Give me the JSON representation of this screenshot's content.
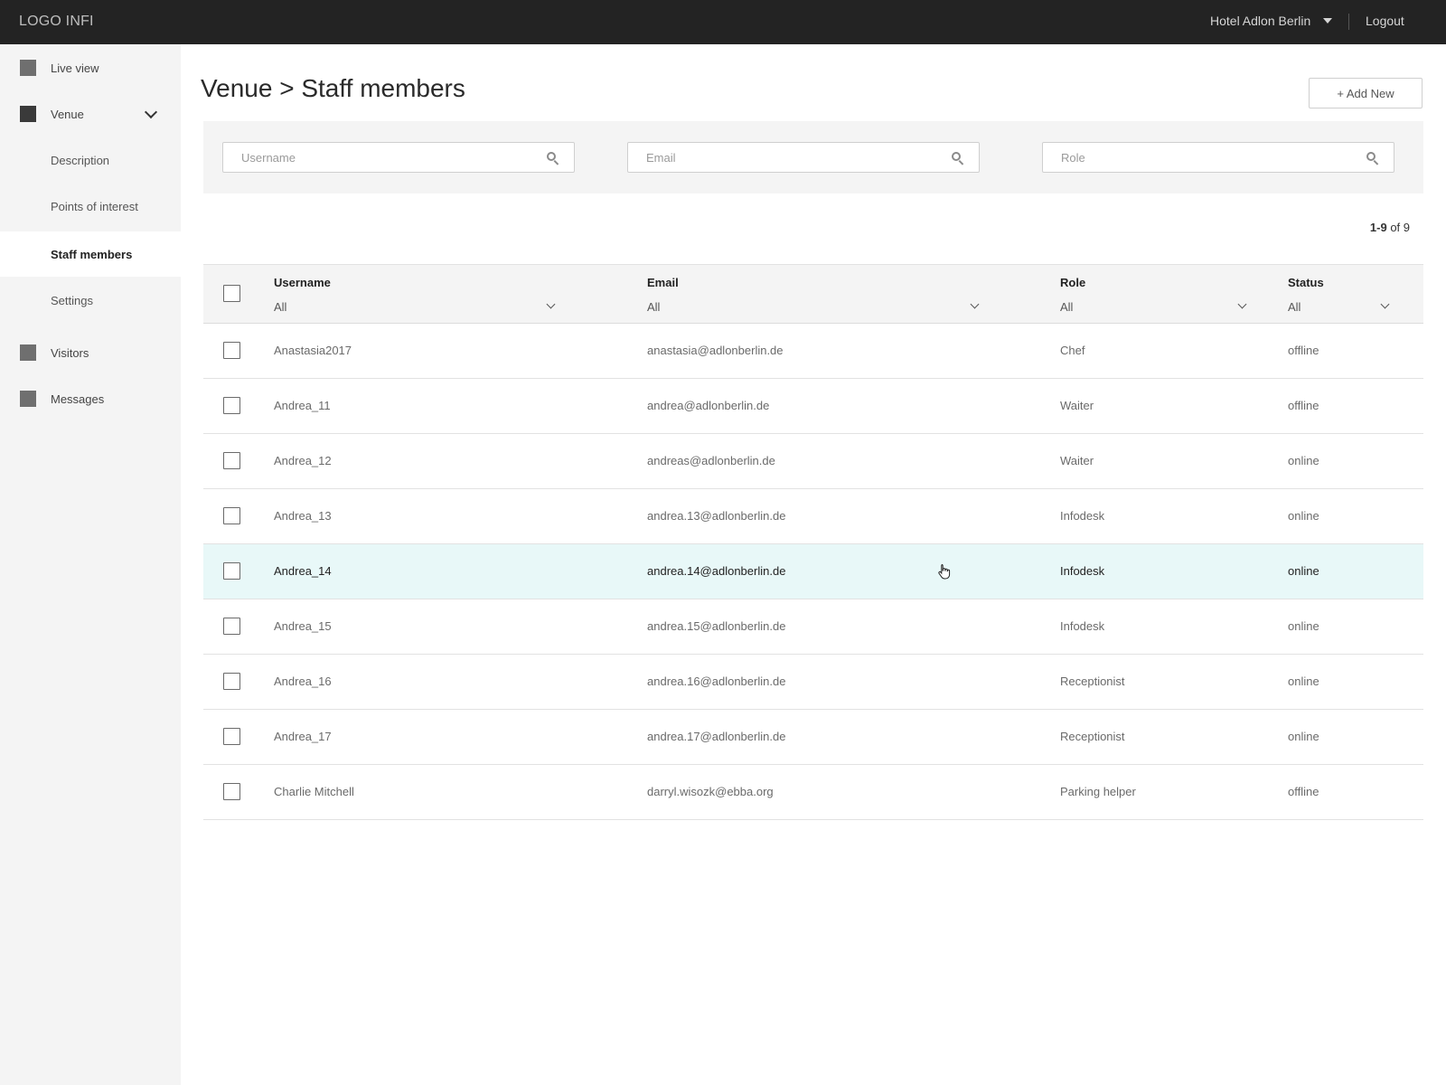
{
  "topbar": {
    "logo": "LOGO INFI",
    "venue": "Hotel Adlon Berlin",
    "logout": "Logout"
  },
  "sidebar": {
    "items": [
      {
        "label": "Live view"
      },
      {
        "label": "Venue"
      },
      {
        "label": "Description"
      },
      {
        "label": "Points of interest"
      },
      {
        "label": "Staff members",
        "active": true
      },
      {
        "label": "Settings"
      },
      {
        "label": "Visitors"
      },
      {
        "label": "Messages"
      }
    ]
  },
  "main": {
    "title": "Venue > Staff members",
    "add_button": "+ Add New",
    "search": {
      "username_placeholder": "Username",
      "email_placeholder": "Email",
      "role_placeholder": "Role"
    },
    "count_range": "1-9",
    "count_of": "of 9"
  },
  "table": {
    "columns": [
      {
        "label": "Username",
        "filter": "All"
      },
      {
        "label": "Email",
        "filter": "All"
      },
      {
        "label": "Role",
        "filter": "All"
      },
      {
        "label": "Status",
        "filter": "All"
      }
    ],
    "rows": [
      {
        "username": "Anastasia2017",
        "email": "anastasia@adlonberlin.de",
        "role": "Chef",
        "status": "offline"
      },
      {
        "username": "Andrea_11",
        "email": "andrea@adlonberlin.de",
        "role": "Waiter",
        "status": "offline"
      },
      {
        "username": "Andrea_12",
        "email": "andreas@adlonberlin.de",
        "role": "Waiter",
        "status": "online"
      },
      {
        "username": "Andrea_13",
        "email": "andrea.13@adlonberlin.de",
        "role": "Infodesk",
        "status": "online"
      },
      {
        "username": "Andrea_14",
        "email": "andrea.14@adlonberlin.de",
        "role": "Infodesk",
        "status": "online",
        "hover": true
      },
      {
        "username": "Andrea_15",
        "email": "andrea.15@adlonberlin.de",
        "role": "Infodesk",
        "status": "online"
      },
      {
        "username": "Andrea_16",
        "email": "andrea.16@adlonberlin.de",
        "role": "Receptionist",
        "status": "online"
      },
      {
        "username": "Andrea_17",
        "email": "andrea.17@adlonberlin.de",
        "role": "Receptionist",
        "status": "online"
      },
      {
        "username": "Charlie Mitchell",
        "email": "darryl.wisozk@ebba.org",
        "role": "Parking helper",
        "status": "offline"
      }
    ]
  },
  "colors": {
    "topbar": "#232323",
    "sidebar": "#f4f4f4",
    "row_hover": "#e8f8f8"
  }
}
